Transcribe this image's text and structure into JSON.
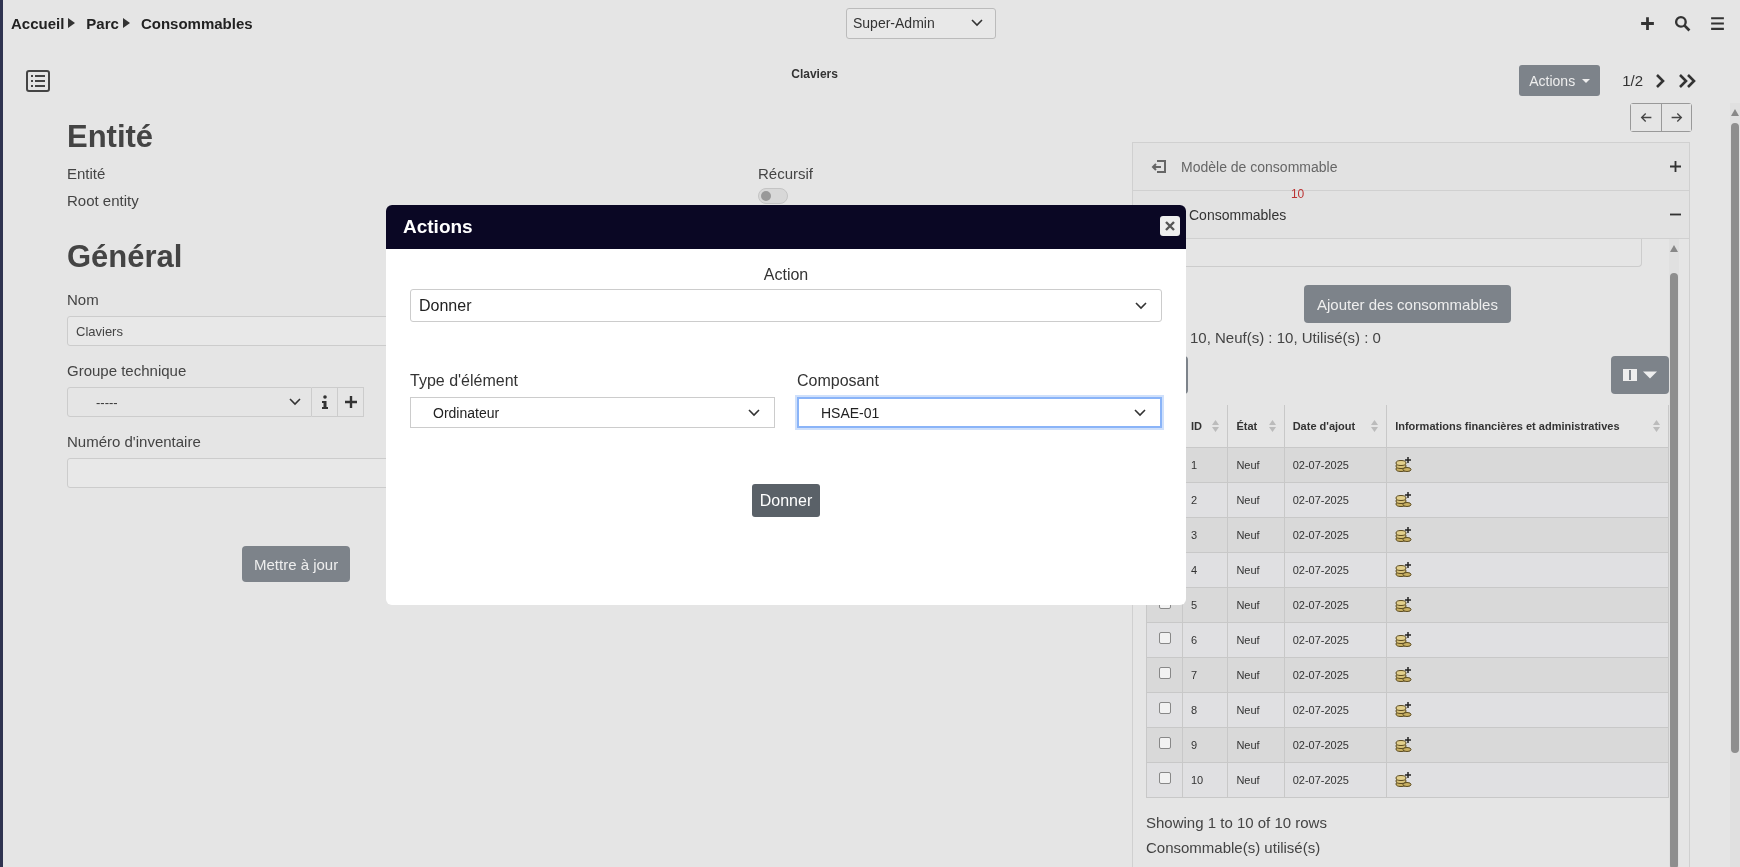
{
  "breadcrumb": [
    {
      "label": "Accueil"
    },
    {
      "label": "Parc"
    },
    {
      "label": "Consommables"
    }
  ],
  "profile_select": {
    "value": "Super-Admin"
  },
  "item_title": "Claviers",
  "actions_button": "Actions",
  "pager": "1/2",
  "entity": {
    "heading": "Entité",
    "label": "Entité",
    "value": "Root entity",
    "recursive_label": "Récursif",
    "recursive_on": false
  },
  "general": {
    "heading": "Général",
    "fields": [
      {
        "kind": "text",
        "label": "Nom",
        "value": "Claviers"
      },
      {
        "kind": "select",
        "label": "Groupe technique",
        "value": "-----"
      },
      {
        "kind": "text",
        "label": "Numéro d'inventaire"
      }
    ]
  },
  "update_button": "Mettre à jour",
  "panels": [
    {
      "title": "Modèle de consommable",
      "expanded": false
    },
    {
      "title": "Consommables",
      "badge": "10",
      "expanded": true
    }
  ],
  "add_button": "Ajouter des consommables",
  "summary": "10, Neuf(s) : 10, Utilisé(s) : 0",
  "table": {
    "columns": [
      "ID",
      "État",
      "Date d'ajout",
      "Informations financières et administratives"
    ],
    "rows": [
      {
        "cells": [
          "1",
          "Neuf",
          "02-07-2025"
        ]
      },
      {
        "cells": [
          "2",
          "Neuf",
          "02-07-2025"
        ]
      },
      {
        "cells": [
          "3",
          "Neuf",
          "02-07-2025"
        ]
      },
      {
        "cells": [
          "4",
          "Neuf",
          "02-07-2025"
        ]
      },
      {
        "checked": false,
        "cells": [
          "5",
          "Neuf",
          "02-07-2025"
        ]
      },
      {
        "checked": false,
        "cells": [
          "6",
          "Neuf",
          "02-07-2025"
        ]
      },
      {
        "checked": false,
        "cells": [
          "7",
          "Neuf",
          "02-07-2025"
        ]
      },
      {
        "checked": false,
        "cells": [
          "8",
          "Neuf",
          "02-07-2025"
        ]
      },
      {
        "checked": false,
        "cells": [
          "9",
          "Neuf",
          "02-07-2025"
        ]
      },
      {
        "checked": false,
        "cells": [
          "10",
          "Neuf",
          "02-07-2025"
        ]
      }
    ]
  },
  "table_footer": "Showing 1 to 10 of 10 rows",
  "used_heading": "Consommable(s) utilisé(s)",
  "modal": {
    "title": "Actions",
    "action_label": "Action",
    "action_value": "Donner",
    "fields": [
      {
        "label": "Type d'élément",
        "value": "Ordinateur",
        "focused": false
      },
      {
        "label": "Composant",
        "value": "HSAE-01",
        "focused": true
      }
    ],
    "submit": "Donner"
  }
}
